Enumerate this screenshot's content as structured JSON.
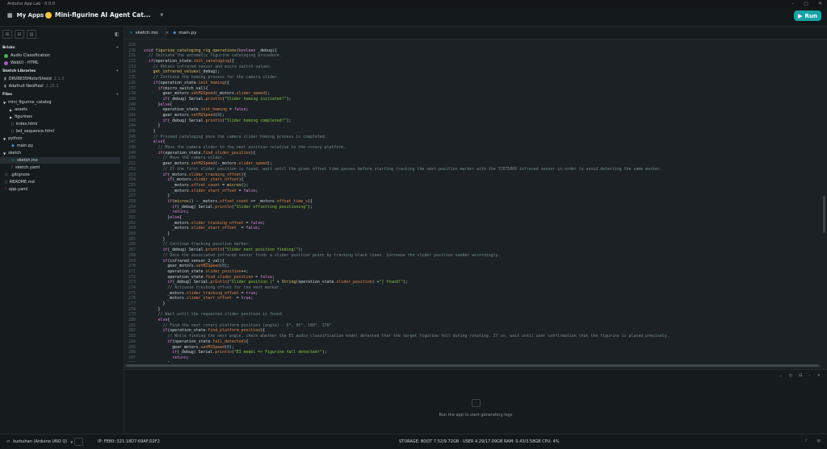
{
  "window": {
    "title": "Arduino App Lab - 0.0.0"
  },
  "topbar": {
    "my_apps": "My Apps",
    "separator": "/",
    "app_name": "Mini-figurine AI Agent Cat...",
    "run_label": "Run"
  },
  "sidebar": {
    "bricks_title": "Bricks",
    "bricks": [
      "Audio Classification",
      "WebUI - HTML"
    ],
    "libraries_title": "Sketch Libraries",
    "libraries": [
      {
        "name": "DRV8835MotorShield",
        "version": "2.1.0"
      },
      {
        "name": "Adafruit NeoPixel",
        "version": "1.15.2"
      }
    ],
    "files_title": "Files",
    "files": [
      "mini_figurine_catalog",
      "assets",
      "figurines",
      "index.html",
      "led_sequence.html",
      "python",
      "main.py",
      "sketch",
      "sketch.ino",
      "sketch.yaml",
      ".gitignore",
      "README.md",
      "app.yaml"
    ]
  },
  "tabs": [
    {
      "label": "sketch.ino"
    },
    {
      "label": "main.py"
    }
  ],
  "code_lines": [
    {
      "n": "229",
      "t": ""
    },
    {
      "n": "230",
      "t": "  void figurine_cataloging_rig_operations(boolean _debug){"
    },
    {
      "n": "231",
      "t": "    // Initiate the automatic figurine cataloging procedure."
    },
    {
      "n": "232",
      "t": "    if(operation_state.init_cataloging){"
    },
    {
      "n": "233",
      "t": "      // Obtain infrared sensor and micro switch values."
    },
    {
      "n": "234",
      "t": "      get_infrared_values(_debug);"
    },
    {
      "n": "235",
      "t": "      // Initiate the homing process for the camera slider."
    },
    {
      "n": "236",
      "t": "      if(operation_state.init_homing){"
    },
    {
      "n": "237",
      "t": "        if(micro_switch_val){"
    },
    {
      "n": "238",
      "t": "          gear_motors.setM2Speed(_motors.slider_speed);"
    },
    {
      "n": "239",
      "t": "          if(_debug) Serial.println(\"Slider homing initiated!\");"
    },
    {
      "n": "240",
      "t": "        }else{"
    },
    {
      "n": "241",
      "t": "          operation_state.init_homing = false;"
    },
    {
      "n": "242",
      "t": "          gear_motors.setM2Speed(0);"
    },
    {
      "n": "243",
      "t": "          if(_debug) Serial.println(\"Slider homing completed!\");"
    },
    {
      "n": "244",
      "t": "        }"
    },
    {
      "n": "245",
      "t": "      }"
    },
    {
      "n": "246",
      "t": "      // Proceed cataloging once the camera slider homing process is completed."
    },
    {
      "n": "247",
      "t": "      else{"
    },
    {
      "n": "248",
      "t": "        // Move the camera slider to the next position relative to the rotary platform."
    },
    {
      "n": "249",
      "t": "        if(operation_state.find_slider_position){"
    },
    {
      "n": "250",
      "t": "          // Move the camera slider."
    },
    {
      "n": "251",
      "t": "          gear_motors.setM2Speed(-_motors.slider_speed);"
    },
    {
      "n": "252",
      "t": "          // If the first slider position is found, wait until the given offset time passes before starting tracking the next position marker with the TCRT5000 infrared sensor in order to avoid detecting the same marker."
    },
    {
      "n": "253",
      "t": "          if(_motors.slider_tracking_offset){"
    },
    {
      "n": "254",
      "t": "            if(_motors.slider_start_offset){"
    },
    {
      "n": "255",
      "t": "              _motors.offset_count = micros();"
    },
    {
      "n": "256",
      "t": "              _motors.slider_start_offset = false;"
    },
    {
      "n": "257",
      "t": "            }"
    },
    {
      "n": "258",
      "t": "            if(micros() - _motors.offset_count >= _motors.offset_time_s){"
    },
    {
      "n": "259",
      "t": "              if(_debug) Serial.println(\"Slider offsetting positioning\");"
    },
    {
      "n": "260",
      "t": "              return;"
    },
    {
      "n": "261",
      "t": "            }else{"
    },
    {
      "n": "262",
      "t": "              _motors.slider_tracking_offset = false;"
    },
    {
      "n": "263",
      "t": "              _motors.slider_start_offset  = false;"
    },
    {
      "n": "264",
      "t": "            }"
    },
    {
      "n": "265",
      "t": "          }"
    },
    {
      "n": "266",
      "t": "          // Continue tracking position marker."
    },
    {
      "n": "267",
      "t": "          if(_debug) Serial.println(\"Slider next position finding!\");"
    },
    {
      "n": "268",
      "t": "          // Once the associated infrared sensor finds a slider position point by tracking black lines, increase the slider position number accordingly."
    },
    {
      "n": "269",
      "t": "          if(infrared_sensor_2_val){"
    },
    {
      "n": "270",
      "t": "            gear_motors.setM2Speed(0);"
    },
    {
      "n": "271",
      "t": "            operation_state.slider_position++;"
    },
    {
      "n": "272",
      "t": "            operation_state.find_slider_position = false;"
    },
    {
      "n": "273",
      "t": "            if(_debug) Serial.println(\"Slider position [\" + String(operation_state.slider_position) +\"] found!\");"
    },
    {
      "n": "274",
      "t": "            // Activate tracking offset for the next marker."
    },
    {
      "n": "275",
      "t": "            _motors.slider_tracking_offset = true;"
    },
    {
      "n": "276",
      "t": "            _motors.slider_start_offset  = true;"
    },
    {
      "n": "277",
      "t": "          }"
    },
    {
      "n": "278",
      "t": "        }"
    },
    {
      "n": "279",
      "t": "        // Wait until the requested slider position is found."
    },
    {
      "n": "280",
      "t": "        else{"
    },
    {
      "n": "281",
      "t": "          // Find the next rotary platform position (angle) - 0°, 90°, 180°, 270°."
    },
    {
      "n": "282",
      "t": "          if(operation_state.find_platform_position){"
    },
    {
      "n": "283",
      "t": "            // While finding the next angle, check whether the EI audio classification model detected that the target figurine fell during rotating. If so, wait until user confirmation that the figurine is placed precisely."
    },
    {
      "n": "284",
      "t": "            if(operation_state.fall_detected){"
    },
    {
      "n": "285",
      "t": "              gear_motors.setM1Speed(0);"
    },
    {
      "n": "286",
      "t": "              if(_debug) Serial.println(\"EI model => Figurine fall detected!\");"
    },
    {
      "n": "287",
      "t": "              return;"
    },
    {
      "n": "288",
      "t": "            }"
    }
  ],
  "console": {
    "message": "Run the app to start generating logs"
  },
  "statusbar": {
    "board": "kurbuhan (Arduino UNO Q)",
    "ip": "IP: FE80::321:18D7:69AF:D2F2",
    "stats": "STORAGE: BOOT 7.52/9.72GB · USER 4.29/17.09GB    RAM: 0.43/3.58GB    CPU: 4%"
  },
  "colors": {
    "accent": "#17a3a6",
    "background": "#1b2124",
    "sidebar": "#161b1d"
  }
}
